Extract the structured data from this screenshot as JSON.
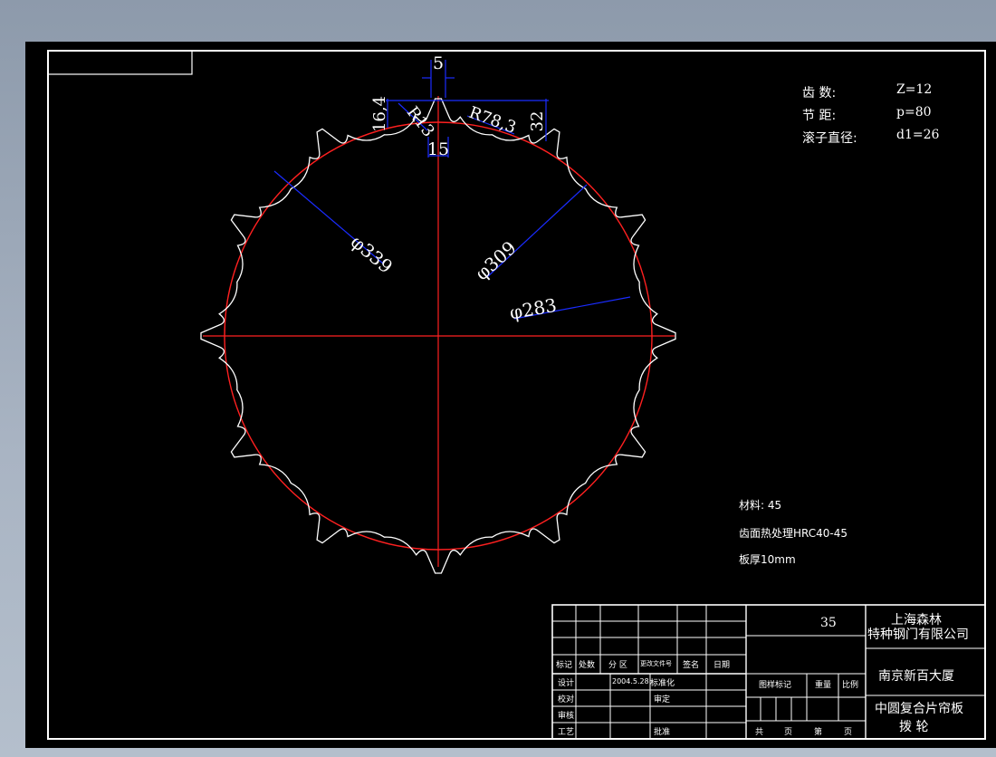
{
  "colors": {
    "background": "#000000",
    "profile": "#ffffff",
    "centerline": "#ff2020",
    "dimension": "#1a2cff",
    "frame": "#ffffff",
    "workspace": "#9aa6b6"
  },
  "specs": {
    "teeth_label": "齿 数:",
    "teeth_value": "Z=12",
    "pitch_label": "节 距:",
    "pitch_value": "p=80",
    "roller_label": "滚子直径:",
    "roller_value": "d1=26"
  },
  "dimensions": {
    "top_gap": "5",
    "tooth_height": "16,4",
    "tip_radius": "R13",
    "flank_radius": "R78,3",
    "depth": "32",
    "tooth_width": "15",
    "dia_outer": "φ339",
    "dia_pitch": "φ309",
    "dia_root": "φ283"
  },
  "notes": {
    "material": "材料: 45",
    "heat_treatment": "齿面热处理HRC40-45",
    "thickness": "板厚10mm"
  },
  "title_block": {
    "quantity": "35",
    "company_line1": "上海森林",
    "company_line2": "特种钢门有限公司",
    "project": "南京新百大厦",
    "part_line1": "中圆复合片帘板",
    "part_line2": "拨 轮",
    "row_headers": [
      "标记",
      "处数",
      "分 区",
      "更改文件号",
      "签名",
      "日期"
    ],
    "design_label": "设计",
    "design_date": "2004.5.28",
    "standardize_label": "标准化",
    "check_label": "校对",
    "review_label": "审定",
    "audit_label": "审核",
    "process_label": "工艺",
    "approve_label": "批准",
    "stage_label": "图样标记",
    "weight_label": "重量",
    "scale_label": "比例",
    "total_label": "共",
    "page_label": "页",
    "sheet_label": "第",
    "sheet_page_label": "页"
  }
}
